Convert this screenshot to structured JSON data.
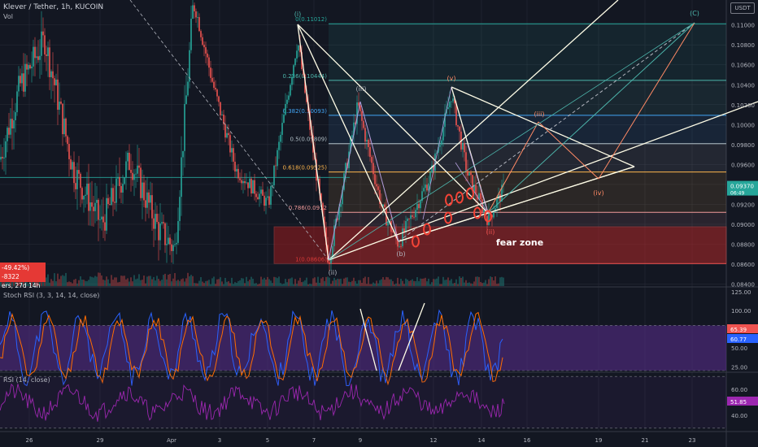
{
  "header": {
    "pair": "Klever / Tether, 1h, KUCOIN",
    "sub": "Vol",
    "currency_button": "USDT"
  },
  "volume_badge": {
    "line1": "-49.42%) -8322",
    "line2": "ers, 27d 14h"
  },
  "colors": {
    "bg": "#131722",
    "grid": "#2a2e39",
    "up": "#26a69a",
    "down": "#ef5350",
    "white_lines": "#fffde7",
    "orange": "#ff8a65",
    "teal": "#4db6ac",
    "purple_band": "#5b2d8f",
    "rsi_line": "#9c27b0",
    "stoch_k": "#2962ff",
    "stoch_d": "#ff6d00"
  },
  "chart_data": [
    {
      "type": "line",
      "title": "Klever / Tether, 1h, KUCOIN",
      "price_axis": [
        "0.11000",
        "0.10800",
        "0.10600",
        "0.10400",
        "0.10200",
        "0.10000",
        "0.09800",
        "0.09600",
        "0.09400",
        "0.09200",
        "0.09000",
        "0.08800",
        "0.08600",
        "0.08400"
      ],
      "ylim": [
        0.0838,
        0.1125
      ],
      "x_ticks": [
        "26",
        "29",
        "Apr",
        "3",
        "5",
        "7",
        "9",
        "12",
        "14",
        "16",
        "19",
        "21",
        "23"
      ],
      "current_price": "0.09370",
      "current_price_sub": "06:49",
      "fib_levels": [
        {
          "ratio": "0",
          "price": 0.11012,
          "label": "0(0.11012)"
        },
        {
          "ratio": "0.236",
          "price": 0.10444,
          "label": "0.236(0.10444)"
        },
        {
          "ratio": "0.382",
          "price": 0.10093,
          "label": "0.382(0.10093)"
        },
        {
          "ratio": "0.5",
          "price": 0.09809,
          "label": "0.5(0.09809)"
        },
        {
          "ratio": "0.618",
          "price": 0.09525,
          "label": "0.618(0.09525)"
        },
        {
          "ratio": "0.786",
          "price": 0.0912,
          "label": "0.786(0.0912"
        },
        {
          "ratio": "1",
          "price": 0.08606,
          "label": "1(0.08606)"
        }
      ],
      "wave_labels": [
        "(i)",
        "(ii)",
        "(iii)",
        "(iv)",
        "(b)",
        "(v)",
        "(ii)",
        "(iii)",
        "(iv)",
        "(C)"
      ],
      "zone_label": "fear zone",
      "zone_range": [
        0.08606,
        0.08975
      ]
    },
    {
      "type": "line",
      "title": "Stoch RSI (3, 3, 14, 14, close)",
      "y_ticks": [
        "125.00",
        "100.00",
        "75.00",
        "50.00",
        "25.00"
      ],
      "ylim": [
        20,
        128
      ],
      "band": [
        20,
        80
      ],
      "series": [
        {
          "name": "K",
          "last": 65.39
        },
        {
          "name": "D",
          "last": 60.77
        }
      ]
    },
    {
      "type": "line",
      "title": "RSI (14, close)",
      "y_ticks": [
        "60.00",
        "40.00"
      ],
      "ylim": [
        28,
        72
      ],
      "band": [
        30,
        70
      ],
      "series": [
        {
          "name": "RSI",
          "last": 51.85
        }
      ]
    }
  ]
}
